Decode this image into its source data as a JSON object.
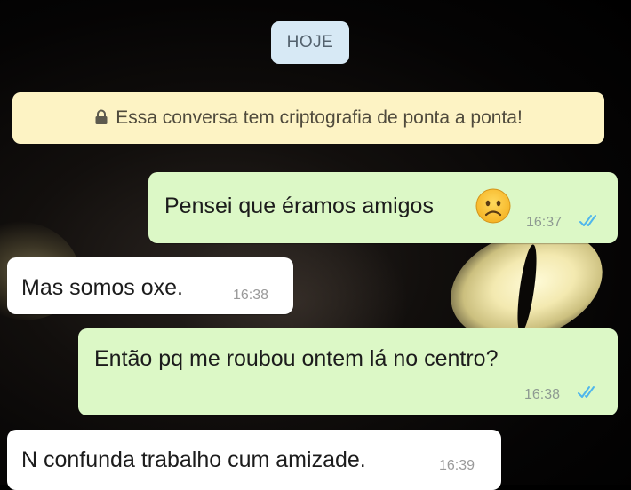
{
  "chat": {
    "date_label": "HOJE",
    "encryption_notice": "Essa conversa tem criptografia de ponta a ponta!",
    "messages": [
      {
        "direction": "outgoing",
        "text": "Pensei que éramos amigos",
        "emoji": "sad-face-emoji",
        "time": "16:37",
        "status": "read"
      },
      {
        "direction": "incoming",
        "text": "Mas somos oxe.",
        "time": "16:38"
      },
      {
        "direction": "outgoing",
        "text": "Então pq me roubou ontem lá no centro?",
        "time": "16:38",
        "status": "read"
      },
      {
        "direction": "incoming",
        "text": "N confunda trabalho cum amizade.",
        "time": "16:39"
      }
    ]
  },
  "colors": {
    "outgoing_bubble": "#dcf8c6",
    "incoming_bubble": "#ffffff",
    "date_chip": "#d7e9f5",
    "encryption_banner": "#fdf3c4",
    "read_ticks": "#4fb6ec"
  },
  "icons": {
    "lock": "lock-icon",
    "read_receipt": "double-check-icon",
    "emoji": "sad-face-emoji"
  }
}
